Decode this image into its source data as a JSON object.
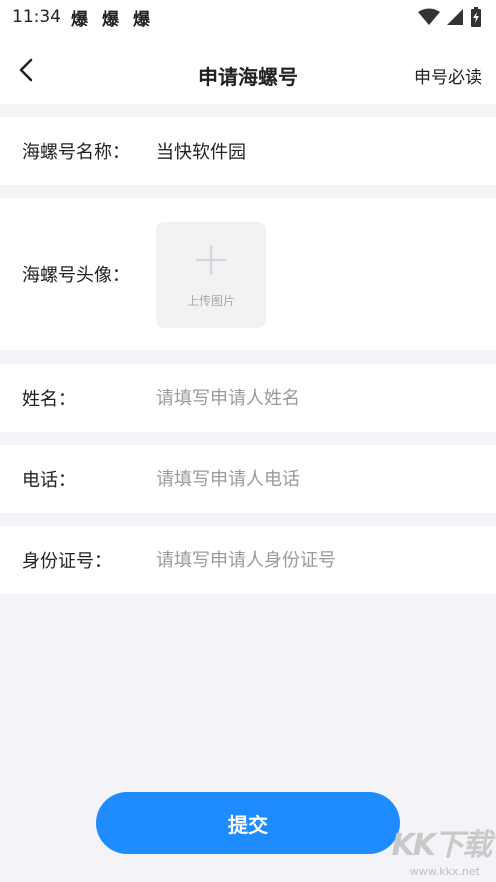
{
  "status_bar": {
    "time": "11:34",
    "notifications": [
      "爆",
      "爆",
      "爆"
    ]
  },
  "nav": {
    "title": "申请海螺号",
    "right_link": "申号必读"
  },
  "form": {
    "name_label": "海螺号名称：",
    "name_value": "当快软件园",
    "avatar_label": "海螺号头像：",
    "avatar_upload_text": "上传图片",
    "applicant_label": "姓名：",
    "applicant_placeholder": "请填写申请人姓名",
    "phone_label": "电话：",
    "phone_placeholder": "请填写申请人电话",
    "id_label": "身份证号：",
    "id_placeholder": "请填写申请人身份证号"
  },
  "submit_label": "提交",
  "watermark": {
    "logo": "KK下载",
    "url": "www.kkx.net"
  },
  "colors": {
    "accent": "#1e8cff",
    "page_background": "#f4f4f8",
    "placeholder": "#9a9a9a"
  }
}
